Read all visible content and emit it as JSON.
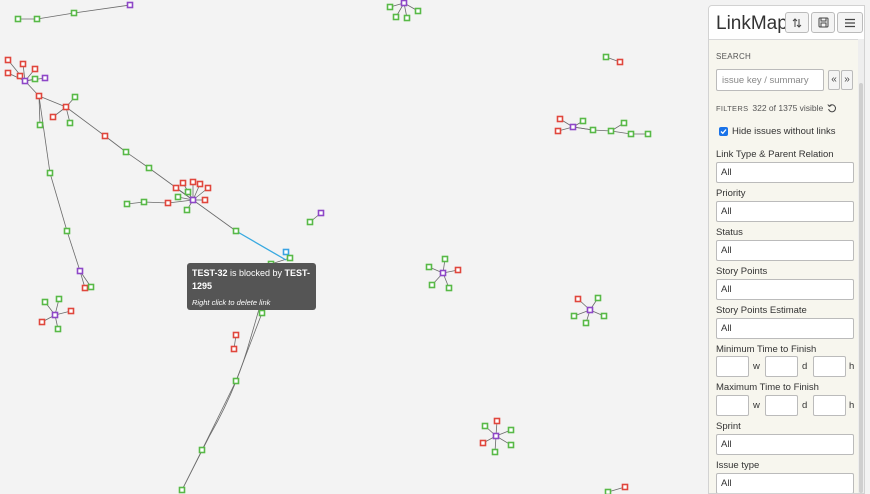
{
  "app_title": "LinkMap",
  "header_buttons": {
    "sort_icon": "sort-arrows-icon",
    "save_icon": "save-icon",
    "menu_icon": "hamburger-menu-icon"
  },
  "search": {
    "label": "SEARCH",
    "placeholder": "issue key / summary",
    "prev": "«",
    "next": "»"
  },
  "filters": {
    "title": "FILTERS",
    "count_text": "322 of 1375 visible",
    "reset_icon": "reset-icon"
  },
  "hide_without_links": {
    "label": "Hide issues without links",
    "checked": true
  },
  "fields": {
    "link_type": {
      "label": "Link Type & Parent Relation",
      "value": "All"
    },
    "priority": {
      "label": "Priority",
      "value": "All"
    },
    "status": {
      "label": "Status",
      "value": "All"
    },
    "story_points": {
      "label": "Story Points",
      "value": "All"
    },
    "story_points_estimate": {
      "label": "Story Points Estimate",
      "value": "All"
    },
    "min_time": {
      "label": "Minimum Time to Finish",
      "units": [
        "w",
        "d",
        "h"
      ]
    },
    "max_time": {
      "label": "Maximum Time to Finish",
      "units": [
        "w",
        "d",
        "h"
      ]
    },
    "sprint": {
      "label": "Sprint",
      "value": "All"
    },
    "issue_type": {
      "label": "Issue type",
      "value": "All"
    }
  },
  "tooltip": {
    "from": "TEST-32",
    "relation": " is blocked by ",
    "to": "TEST-1295",
    "hint": "Right click to delete link"
  },
  "colors": {
    "green": "#58b947",
    "red": "#e0463c",
    "purple": "#8e47c7",
    "blue": "#3aa3e3",
    "edge": "#6a6a6a",
    "highlight_edge": "#38a9e0"
  }
}
